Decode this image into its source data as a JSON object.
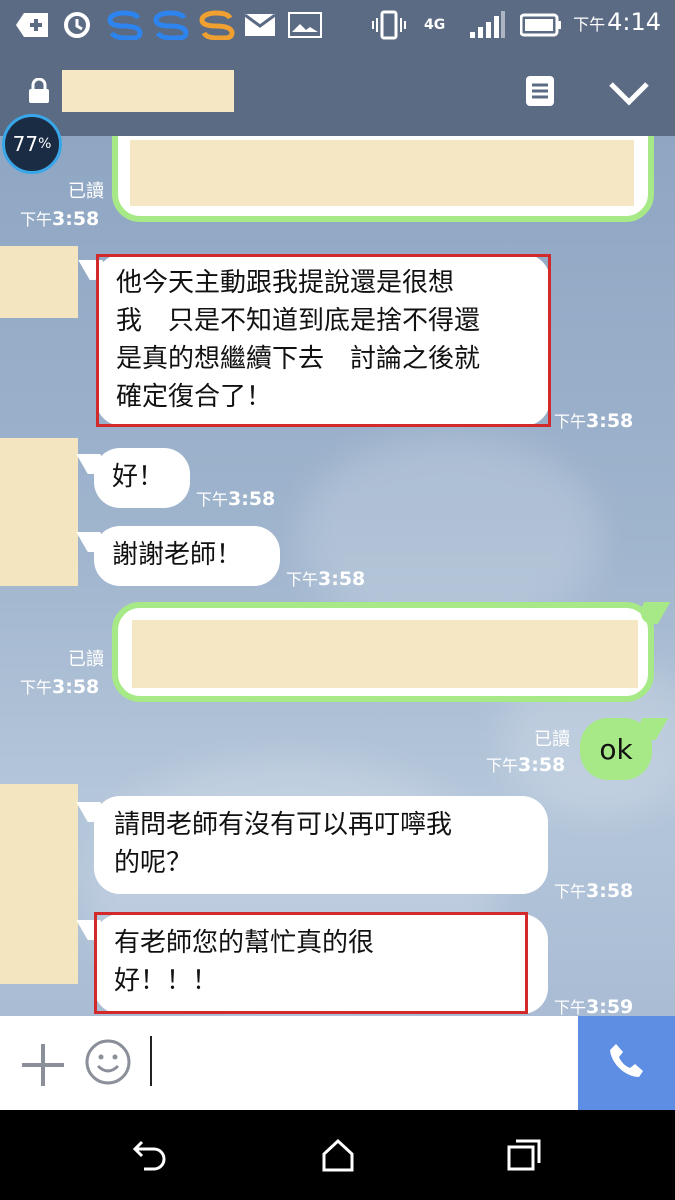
{
  "status_bar": {
    "time_prefix": "下午",
    "time": "4:14",
    "network": "4G",
    "icons": [
      "add-box-icon",
      "sync-icon",
      "s-app-blue-icon",
      "s-app-blue-icon",
      "s-app-orange-icon",
      "mail-icon",
      "image-icon",
      "vibrate-icon",
      "signal-icon",
      "battery-icon"
    ]
  },
  "header": {
    "menu_icon": "note-icon",
    "collapse_icon": "chevron-down-icon"
  },
  "badge": {
    "percent": "77",
    "suffix": "%"
  },
  "messages": {
    "m1": {
      "read": "已讀",
      "time_prefix": "下午",
      "time": "3:58"
    },
    "m2": {
      "line1": "他今天主動跟我提說還是很想",
      "line2": "我　只是不知道到底是捨不得還",
      "line3": "是真的想繼續下去　討論之後就",
      "line4": "確定復合了！",
      "time_prefix": "下午",
      "time": "3:58"
    },
    "m3": {
      "text": "好！",
      "time_prefix": "下午",
      "time": "3:58"
    },
    "m4": {
      "text": "謝謝老師！",
      "time_prefix": "下午",
      "time": "3:58"
    },
    "m5": {
      "read": "已讀",
      "time_prefix": "下午",
      "time": "3:58"
    },
    "m6": {
      "text": "ok",
      "read": "已讀",
      "time_prefix": "下午",
      "time": "3:58"
    },
    "m7": {
      "line1": "請問老師有沒有可以再叮嚀我",
      "line2": "的呢？",
      "time_prefix": "下午",
      "time": "3:58"
    },
    "m8": {
      "line1": "有老師您的幫忙真的很",
      "line2": "好！！！",
      "time_prefix": "下午",
      "time": "3:59"
    }
  },
  "colors": {
    "highlight": "#d22a2a",
    "outgoing": "#a6e986",
    "call": "#5d8ee4",
    "header": "#5b6b84"
  }
}
